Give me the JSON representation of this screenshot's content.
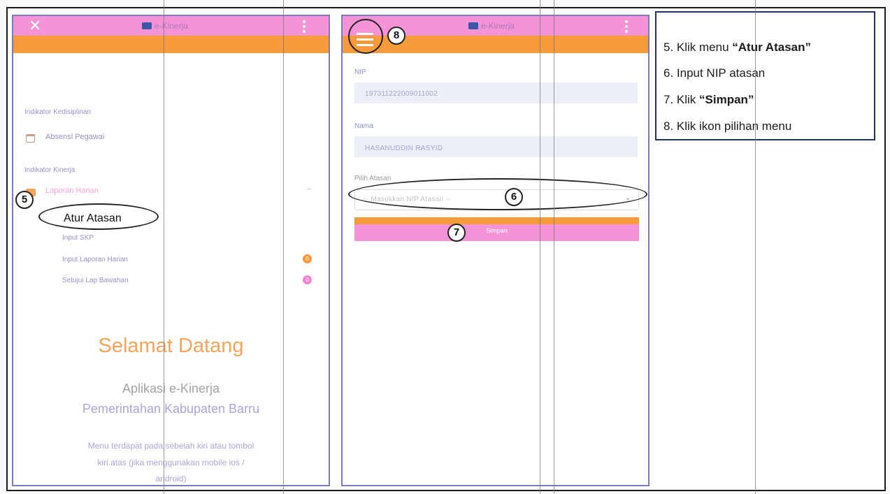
{
  "left_phone": {
    "app_title": "e-Kinerja",
    "close_icon": "close-icon",
    "section_discipline": "Indikator Kedisiplinan",
    "absensi_label": "Absensi Pegawai",
    "section_performance": "Indikator Kinerja",
    "laporan_label": "Laporan Harian",
    "atur_atasan_label": "Atur Atasan",
    "input_skp_label": "Input SKP",
    "input_laporan_label": "Input Laporan Harian",
    "input_laporan_badge": "0",
    "setujui_label": "Setujui Lap Bawahan",
    "setujui_badge": "0",
    "welcome_title": "Selamat Datang",
    "welcome_app": "Aplikasi e-Kinerja",
    "welcome_org": "Pemerintahan Kabupaten Barru",
    "welcome_note_1": "Menu terdapat pada sebelah kiri atau tombol",
    "welcome_note_2": "kiri atas (jika menggunakan mobile ios /",
    "welcome_note_3": "android)",
    "callout_5": "5"
  },
  "right_phone": {
    "app_title": "e-Kinerja",
    "nip_label": "NIP",
    "nip_value": "197311222009011002",
    "nama_label": "Nama",
    "nama_value": "HASANUDDIN RASYID",
    "pilih_label": "Pilih Atasan",
    "pilih_placeholder": "-- Masukkan NIP Atasan --",
    "simpan_label": "Simpan",
    "callout_6": "6",
    "callout_7": "7",
    "callout_8": "8"
  },
  "instructions": {
    "step5_prefix": "5.  Klik menu ",
    "step5_bold": "“Atur Atasan”",
    "step6": "6.  Input NIP atasan",
    "step7_prefix": "7.  Klik ",
    "step7_bold": "“Simpan”",
    "step8": "8.  Klik ikon pilihan menu"
  },
  "colors": {
    "pink": "#f493d6",
    "orange": "#f79a3c",
    "label_purple": "#9a90c7"
  }
}
